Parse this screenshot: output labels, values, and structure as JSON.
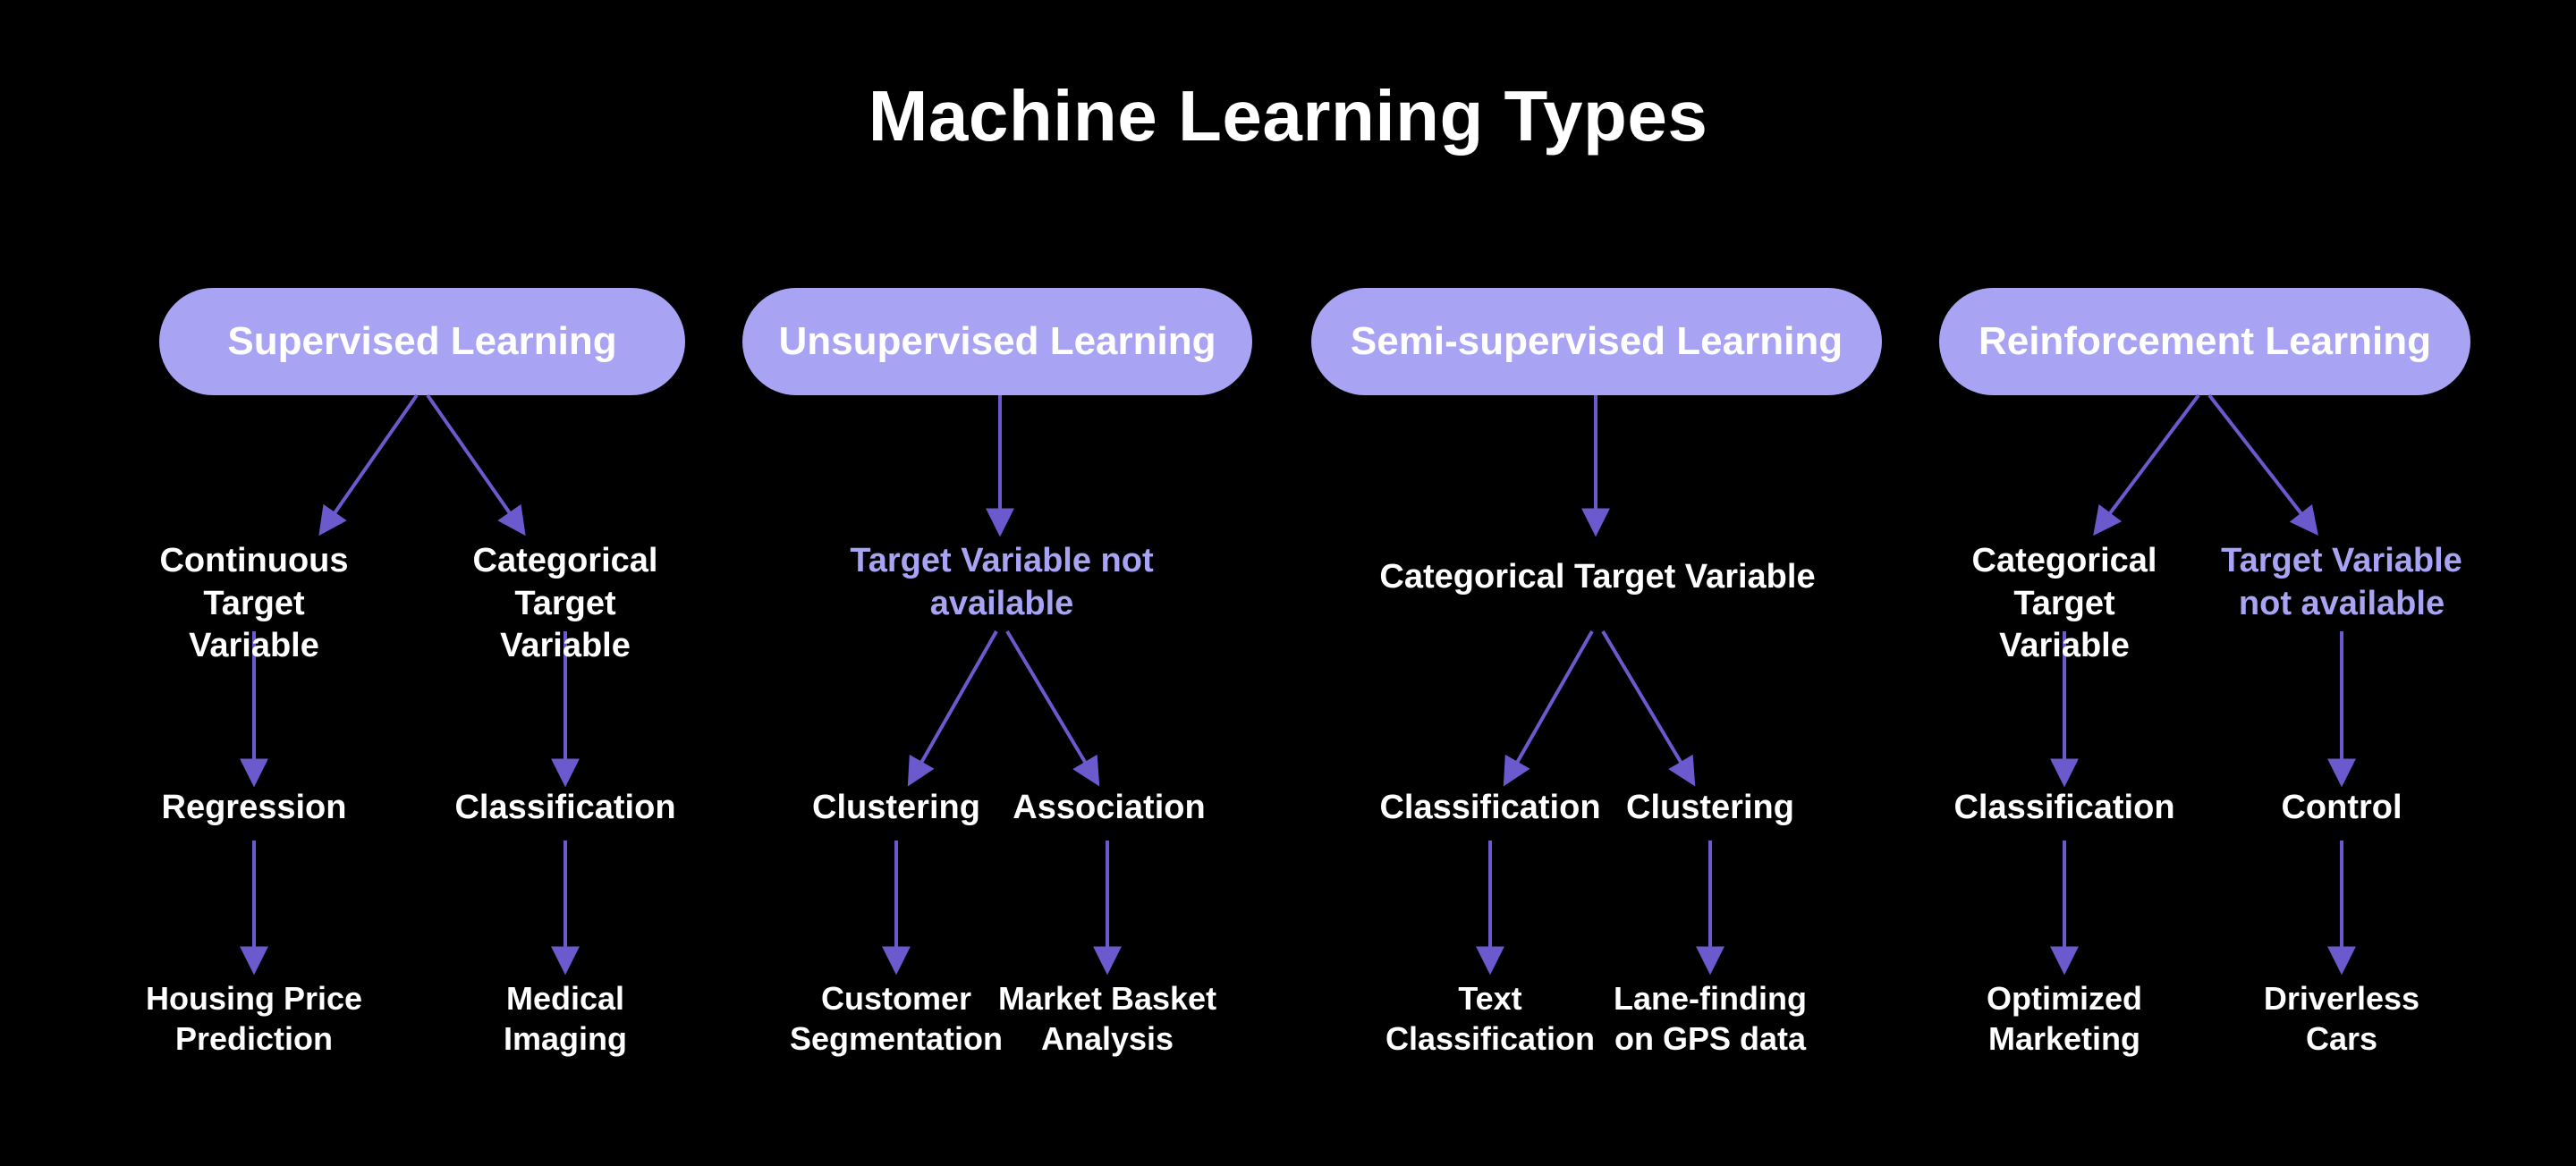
{
  "title": "Machine Learning Types",
  "accent_color": "#A8A3F3",
  "edge_color": "#6A5ACD",
  "branches": {
    "supervised": {
      "label": "Supervised Learning"
    },
    "unsupervised": {
      "label": "Unsupervised Learning"
    },
    "semi": {
      "label": "Semi-supervised Learning"
    },
    "reinforcement": {
      "label": "Reinforcement Learning"
    }
  },
  "intermediate": {
    "sup_cont": "Continuous\nTarget Variable",
    "sup_cat": "Categorical\nTarget Variable",
    "unsup_na": "Target Variable not\navailable",
    "semi_cat": "Categorical Target Variable",
    "rl_cat": "Categorical\nTarget Variable",
    "rl_na": "Target Variable\nnot available"
  },
  "methods": {
    "regression": "Regression",
    "classification_sup": "Classification",
    "clustering_unsup": "Clustering",
    "association": "Association",
    "classification_semi": "Classification",
    "clustering_semi": "Clustering",
    "classification_rl": "Classification",
    "control": "Control"
  },
  "applications": {
    "housing": "Housing Price\nPrediction",
    "medical": "Medical\nImaging",
    "customer": "Customer\nSegmentation",
    "market": "Market Basket\nAnalysis",
    "text": "Text\nClassification",
    "lane": "Lane-finding\non GPS data",
    "optimized": "Optimized\nMarketing",
    "driverless": "Driverless\nCars"
  }
}
